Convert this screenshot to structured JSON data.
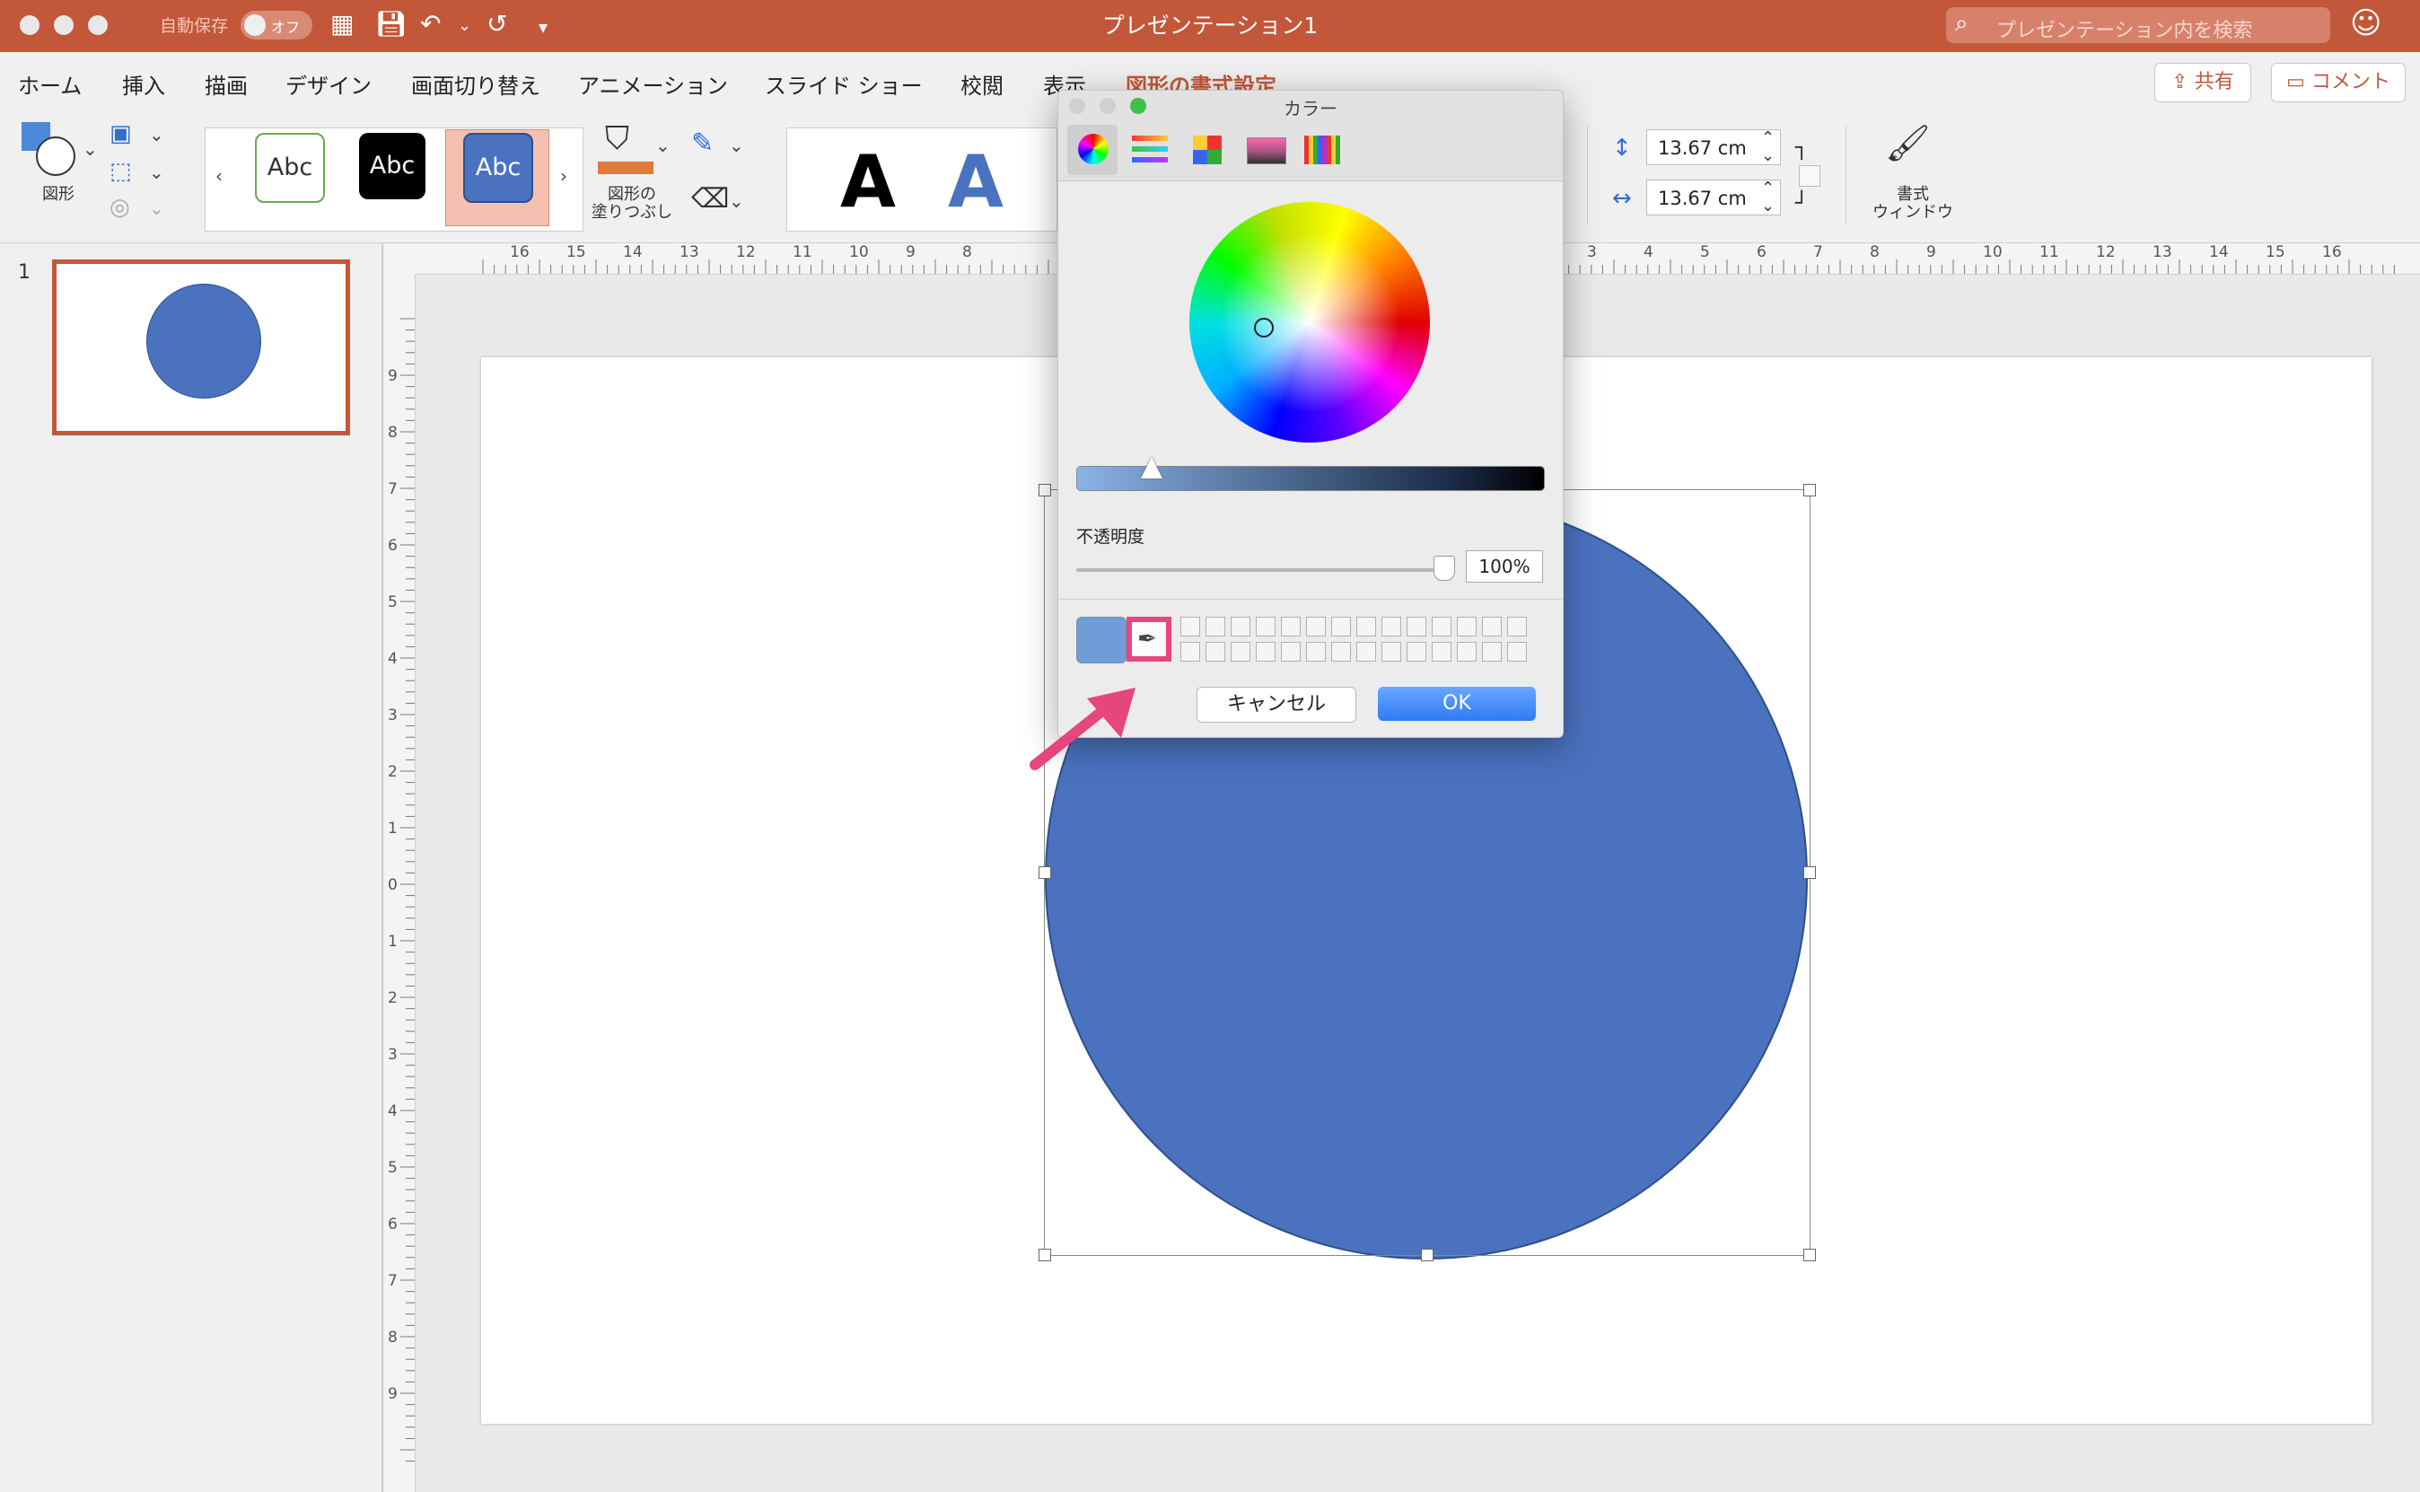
{
  "titlebar": {
    "title": "プレゼンテーション1",
    "autosave": "自動保存",
    "autosave_state": "オフ",
    "search_placeholder": "プレゼンテーション内を検索"
  },
  "menu": {
    "tabs": [
      "ホーム",
      "挿入",
      "描画",
      "デザイン",
      "画面切り替え",
      "アニメーション",
      "スライド ショー",
      "校閲",
      "表示",
      "図形の書式設定"
    ],
    "share": "共有",
    "comment": "コメント"
  },
  "ribbon": {
    "shapes_label": "図形",
    "style_samples": [
      "Abc",
      "Abc",
      "Abc"
    ],
    "fill_label_1": "図形の",
    "fill_label_2": "塗りつぶし",
    "wordart_samples": [
      "A",
      "A"
    ],
    "height_value": "13.67 cm",
    "width_value": "13.67 cm",
    "format_pane_label_1": "書式",
    "format_pane_label_2": "ウィンドウ"
  },
  "slides_panel": {
    "slide_number": "1"
  },
  "rulers": {
    "h_left": [
      "16",
      "15",
      "14",
      "13",
      "12",
      "11",
      "10",
      "9",
      "8"
    ],
    "h_right": [
      "3",
      "4",
      "5",
      "6",
      "7",
      "8",
      "9",
      "10",
      "11",
      "12",
      "13",
      "14",
      "15",
      "16"
    ],
    "v": [
      "9",
      "8",
      "7",
      "6",
      "5",
      "4",
      "3",
      "2",
      "1",
      "0",
      "1",
      "2",
      "3",
      "4",
      "5",
      "6",
      "7",
      "8",
      "9"
    ]
  },
  "color_dialog": {
    "title": "カラー",
    "opacity_label": "不透明度",
    "opacity_value": "100%",
    "cancel": "キャンセル",
    "ok": "OK",
    "current_color": "#6e9dd8"
  },
  "colors": {
    "accent": "#c2573a",
    "shape_fill": "#4a72bf",
    "highlight": "#e6467e",
    "ok_blue": "#2d7bf4"
  }
}
